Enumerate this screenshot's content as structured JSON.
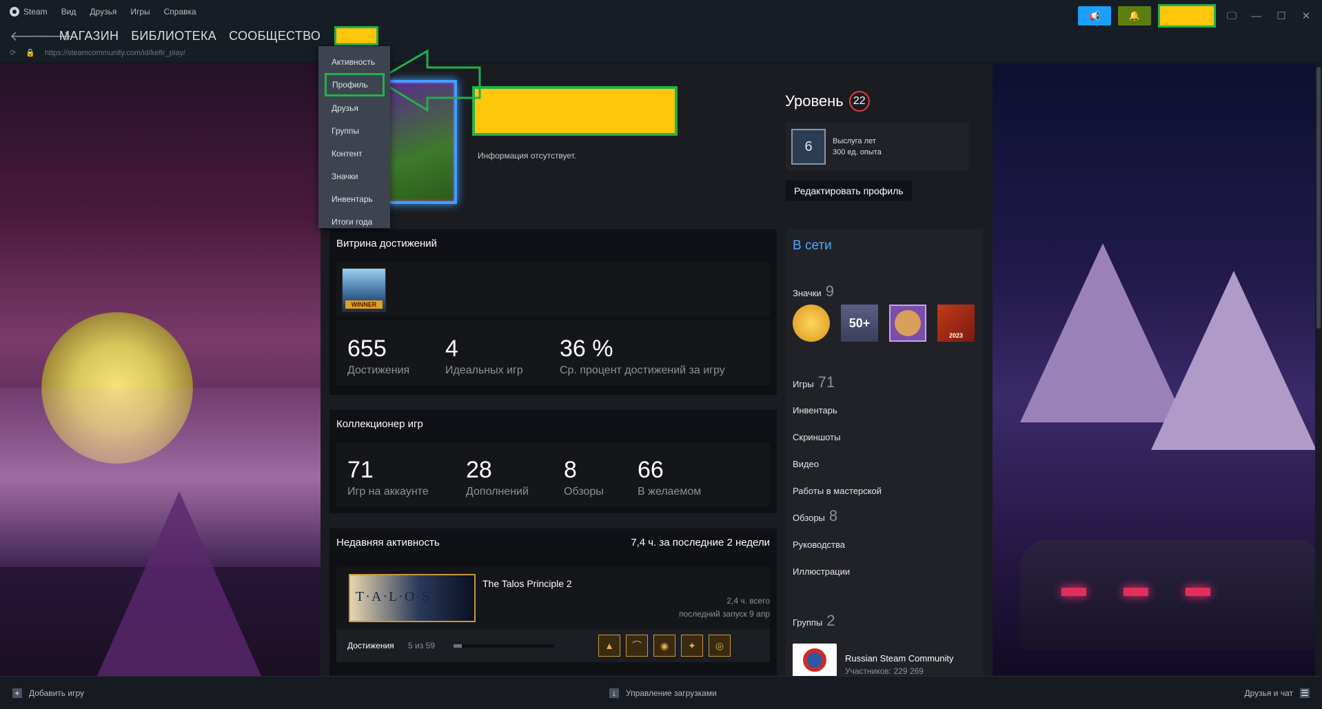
{
  "menubar": {
    "app": "Steam",
    "items": [
      "Вид",
      "Друзья",
      "Игры",
      "Справка"
    ]
  },
  "nav": {
    "store": "МАГАЗИН",
    "library": "БИБЛИОТЕКА",
    "community": "СООБЩЕСТВО",
    "url": "https://steamcommunity.com/id/kefir_play/"
  },
  "dropdown": {
    "items": [
      "Активность",
      "Профиль",
      "Друзья",
      "Группы",
      "Контент",
      "Значки",
      "Инвентарь",
      "Итоги года"
    ],
    "active_index": 1
  },
  "profile": {
    "info": "Информация отсутствует."
  },
  "level": {
    "label": "Уровень",
    "value": "22",
    "xp_title": "Выслуга лет",
    "xp_value": "300 ед. опыта",
    "badge_years": "6",
    "edit_button": "Редактировать профиль"
  },
  "showcase": {
    "title": "Витрина достижений",
    "game_badge_text": "WINNER",
    "stats": [
      {
        "num": "655",
        "label": "Достижения"
      },
      {
        "num": "4",
        "label": "Идеальных игр"
      },
      {
        "num": "36 %",
        "label": "Ср. процент достижений за игру"
      }
    ]
  },
  "collector": {
    "title": "Коллекционер игр",
    "stats": [
      {
        "num": "71",
        "label": "Игр на аккаунте"
      },
      {
        "num": "28",
        "label": "Дополнений"
      },
      {
        "num": "8",
        "label": "Обзоры"
      },
      {
        "num": "66",
        "label": "В желаемом"
      }
    ]
  },
  "recent": {
    "title": "Недавняя активность",
    "summary": "7,4 ч. за последние 2 недели",
    "game": {
      "name": "The Talos Principle 2",
      "hours": "2,4 ч. всего",
      "last_played": "последний запуск 9 апр",
      "cover_text": "T·A·L·O·S",
      "achievements_label": "Достижения",
      "achievements_value": "5 из 59",
      "achievements_progress": 0.085
    }
  },
  "sidebar": {
    "online": "В сети",
    "badges_label": "Значки",
    "badges_count": "9",
    "badge_50": "50+",
    "badge_2023": "2023",
    "games_label": "Игры",
    "games_count": "71",
    "inventory": "Инвентарь",
    "screenshots": "Скриншоты",
    "videos": "Видео",
    "workshop": "Работы в мастерской",
    "reviews_label": "Обзоры",
    "reviews_count": "8",
    "guides": "Руководства",
    "artwork": "Иллюстрации",
    "groups_label": "Группы",
    "groups_count": "2",
    "group_name": "Russian Steam Community",
    "group_members": "Участников: 229 269"
  },
  "bottombar": {
    "add_game": "Добавить игру",
    "downloads": "Управление загрузками",
    "friends_chat": "Друзья и чат"
  },
  "colors": {
    "highlight_yellow": "#ffc60a",
    "highlight_green": "#22b14c",
    "online_blue": "#57a7ff",
    "level_red": "#e63b3b"
  }
}
